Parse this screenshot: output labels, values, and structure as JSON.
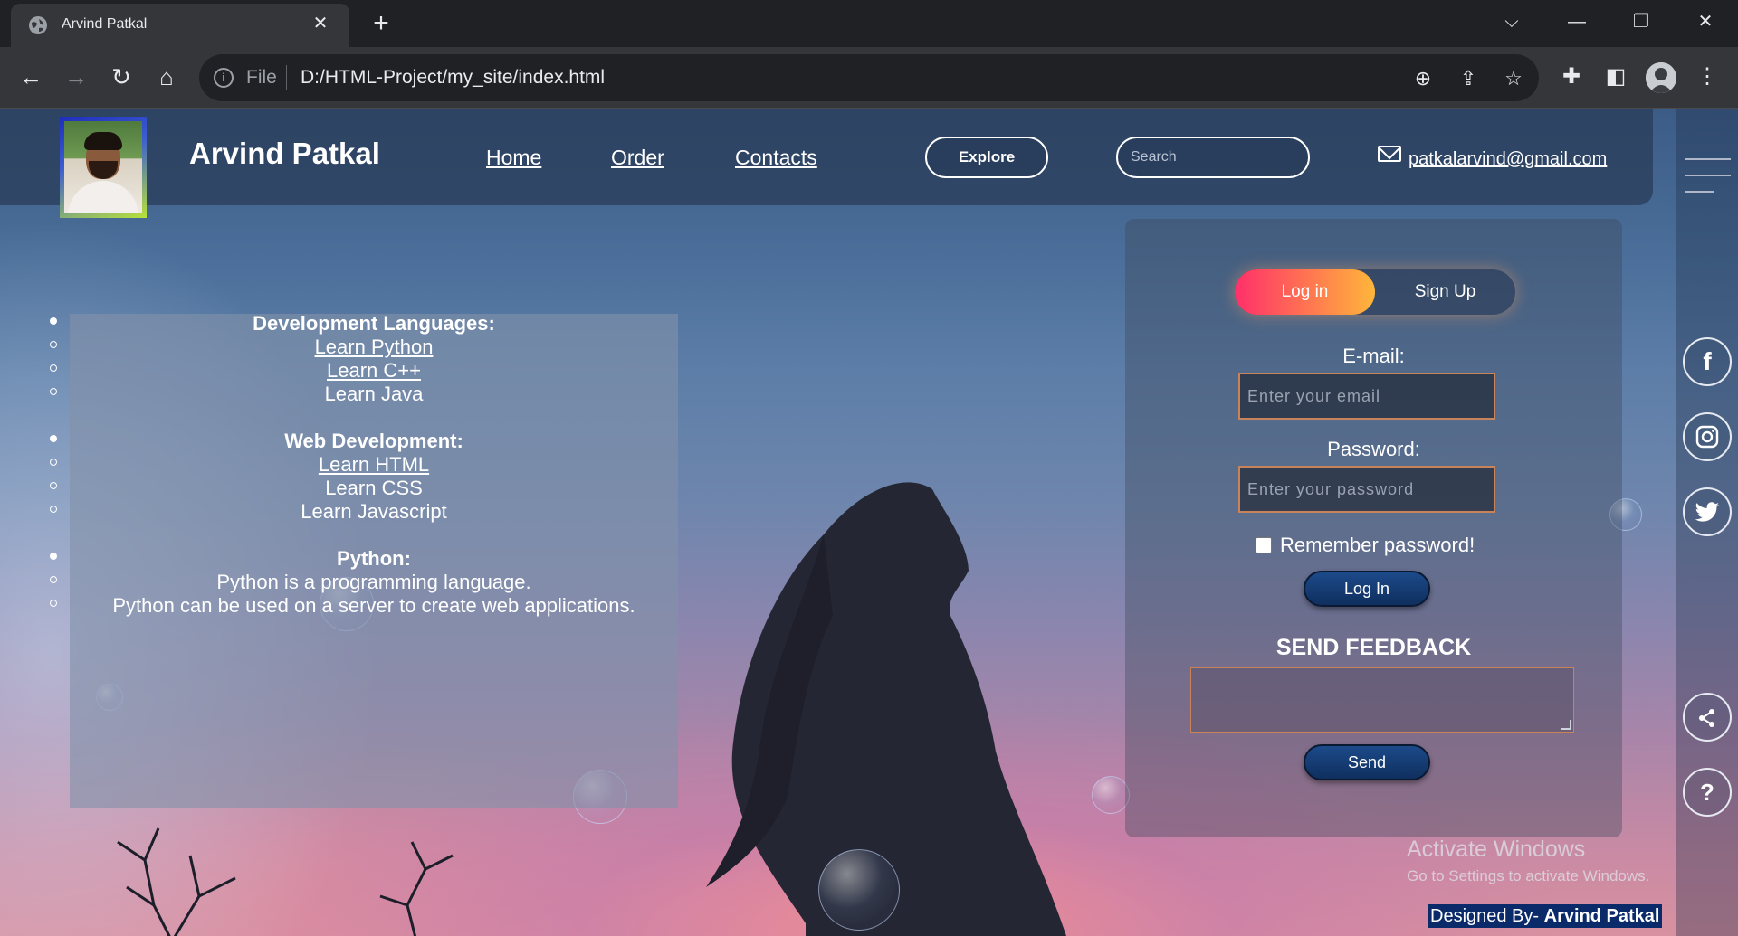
{
  "browser": {
    "tab_title": "Arvind Patkal",
    "url_scheme": "File",
    "url": "D:/HTML-Project/my_site/index.html"
  },
  "header": {
    "brand": "Arvind Patkal",
    "nav": {
      "home": "Home",
      "order": "Order",
      "contacts": "Contacts"
    },
    "explore_label": "Explore",
    "search_placeholder": "Search",
    "email": "patkalarvind@gmail.com"
  },
  "info_panel": {
    "dev_heading": "Development Languages:",
    "dev_items": [
      "Learn Python",
      "Learn C++",
      "Learn Java"
    ],
    "web_heading": "Web Development:",
    "web_items": [
      "Learn HTML",
      "Learn CSS",
      "Learn Javascript"
    ],
    "python_heading": "Python:",
    "python_lines": [
      "Python is a programming language.",
      "Python can be used on a server to create web applications."
    ]
  },
  "login_form": {
    "tab_login": "Log in",
    "tab_signup": "Sign Up",
    "email_label": "E-mail:",
    "email_placeholder": "Enter your email",
    "password_label": "Password:",
    "password_placeholder": "Enter your password",
    "remember_label": "Remember password!",
    "login_button": "Log In",
    "feedback_title": "SEND FEEDBACK",
    "send_button": "Send"
  },
  "social": {
    "facebook": "f",
    "help": "?"
  },
  "watermark": {
    "line1": "Activate Windows",
    "line2": "Go to Settings to activate Windows."
  },
  "footer": {
    "prefix": "Designed By- ",
    "name": "Arvind Patkal"
  },
  "colors": {
    "accent_gradient_start": "#ff2f6a",
    "accent_gradient_end": "#ffb63a",
    "button_blue": "#1c4a8a",
    "footer_bg": "#0b2a6a"
  }
}
